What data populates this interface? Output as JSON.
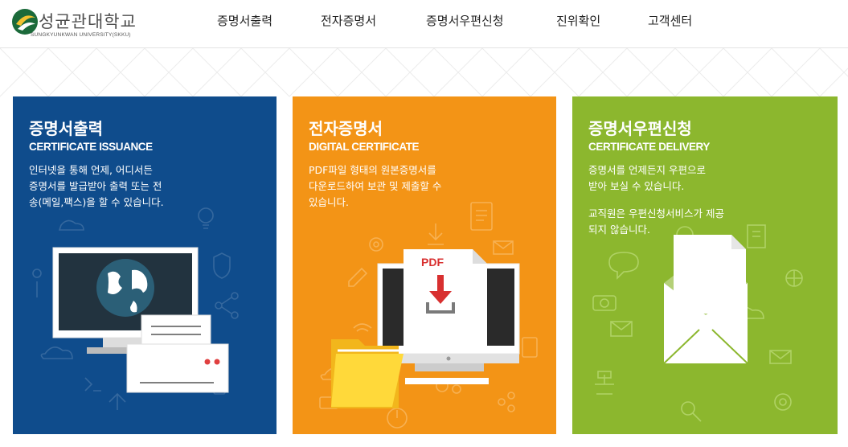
{
  "header": {
    "logo_name": "성균관대학교",
    "logo_eng": "SUNGKYUNKWAN UNIVERSITY(SKKU)",
    "nav": [
      "증명서출력",
      "전자증명서",
      "증명서우편신청",
      "진위확인",
      "고객센터"
    ]
  },
  "cards": [
    {
      "title": "증명서출력",
      "subtitle": "CERTIFICATE ISSUANCE",
      "desc": [
        "인터넷을 통해 언제, 어디서든",
        "증명서를 발급받아 출력 또는 전",
        "송(메일,팩스)을 할 수 있습니다."
      ],
      "color": "#0f4c8c"
    },
    {
      "title": "전자증명서",
      "subtitle": "DIGITAL CERTIFICATE",
      "desc": [
        "PDF파일 형태의 원본증명서를",
        "다운로드하여 보관 및 제출할 수",
        "있습니다."
      ],
      "pdf_label": "PDF",
      "color": "#f39416"
    },
    {
      "title": "증명서우편신청",
      "subtitle": "CERTIFICATE DELIVERY",
      "desc": [
        "증명서를 언제든지 우편으로",
        "받아 보실 수 있습니다."
      ],
      "desc2": [
        "교직원은 우편신청서비스가 제공",
        "되지 않습니다."
      ],
      "color": "#8cb72e"
    }
  ]
}
